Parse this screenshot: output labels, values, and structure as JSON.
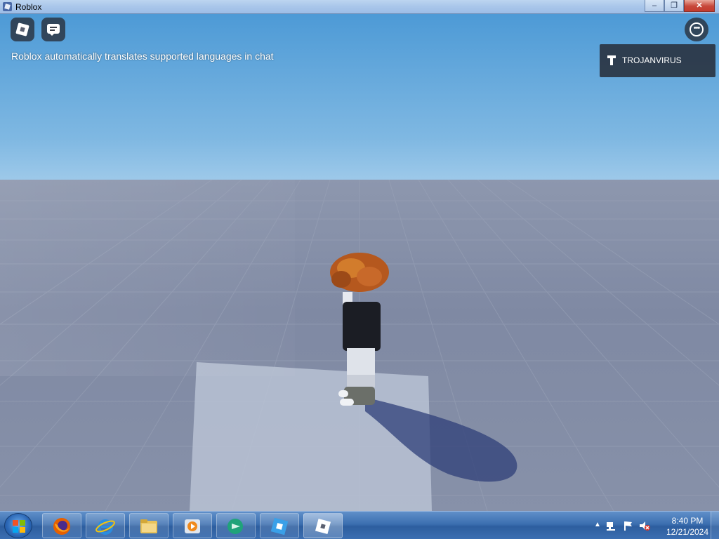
{
  "window": {
    "title": "Roblox",
    "controls": {
      "minimize": "‒",
      "restore": "❐",
      "close": "✕"
    }
  },
  "hud": {
    "roblox_menu_icon": "roblox-logo-icon",
    "chat_icon": "chat-icon",
    "more_icon": "more-options-icon",
    "more_glyph": "•••",
    "chat_notice": "Roblox automatically translates supported languages in chat"
  },
  "player_list": {
    "players": [
      {
        "name": "TROJANVIRUS",
        "icon": "hammer-icon"
      }
    ]
  },
  "taskbar": {
    "pinned": [
      {
        "name": "firefox",
        "icon": "firefox-icon"
      },
      {
        "name": "internet-explorer",
        "icon": "internet-explorer-icon"
      },
      {
        "name": "file-explorer",
        "icon": "folder-icon"
      },
      {
        "name": "media-player",
        "icon": "media-player-icon"
      },
      {
        "name": "app-globe",
        "icon": "globe-arrow-icon"
      },
      {
        "name": "roblox-studio",
        "icon": "roblox-studio-icon"
      },
      {
        "name": "roblox",
        "icon": "roblox-icon",
        "active": true
      }
    ],
    "tray": {
      "expand_glyph": "▲",
      "time": "8:40 PM",
      "date": "12/21/2024"
    }
  },
  "colors": {
    "sky_top": "#4d9ad6",
    "horizon": "#c8dff2",
    "baseplate": "#8892aa",
    "spawn_pad": "#b9c2d3",
    "taskbar": "#3c6fb0",
    "hud_bg": "#282d37"
  }
}
